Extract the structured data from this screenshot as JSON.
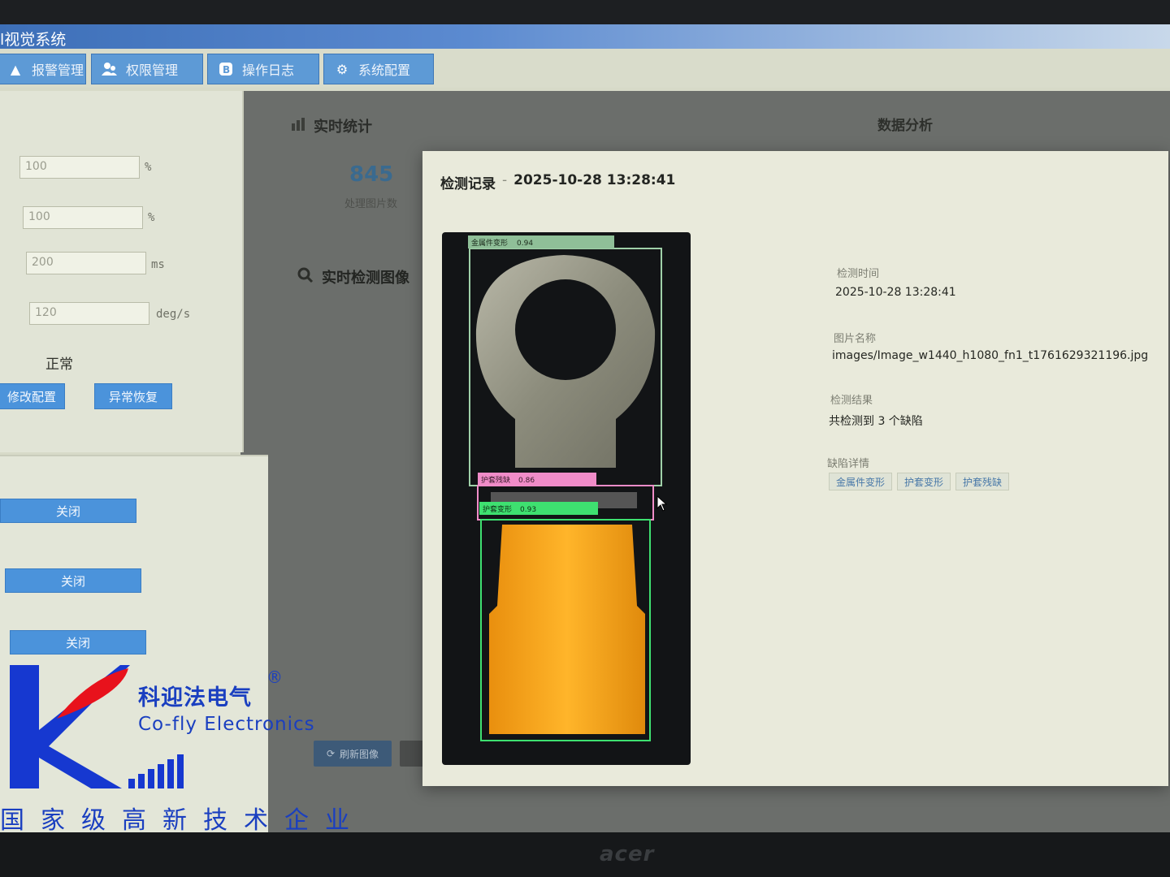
{
  "app": {
    "title": "l视觉系统"
  },
  "nav": [
    {
      "label": "报警管理",
      "icon": "bell-icon"
    },
    {
      "label": "权限管理",
      "icon": "users-icon"
    },
    {
      "label": "操作日志",
      "icon": "log-icon"
    },
    {
      "label": "系统配置",
      "icon": "gear-icon"
    }
  ],
  "settings": {
    "fields": [
      {
        "value": "100",
        "unit": "%"
      },
      {
        "value": "100",
        "unit": "%"
      },
      {
        "value": "200",
        "unit": "ms"
      },
      {
        "value": "120",
        "unit": "deg/s"
      }
    ],
    "status": "正常",
    "modify_button": "修改配置",
    "recover_button": "异常恢复"
  },
  "toggles": [
    {
      "label": "关闭"
    },
    {
      "label": "关闭"
    },
    {
      "label": "关闭"
    }
  ],
  "stats": {
    "title": "实时统计",
    "value": "845",
    "sublabel": "处理图片数"
  },
  "realtime": {
    "title": "实时检测图像"
  },
  "analysis": {
    "title": "数据分析"
  },
  "actions": {
    "refresh": "刷新图像"
  },
  "modal": {
    "title": "检测记录",
    "separator": "-",
    "timestamp": "2025-10-28 13:28:41",
    "detections": [
      {
        "label": "金属件变形",
        "score": "0.94",
        "color": "#8fbf98"
      },
      {
        "label": "护套残缺",
        "score": "0.86",
        "color": "#f08cc8"
      },
      {
        "label": "护套变形",
        "score": "0.93",
        "color": "#3ee070"
      }
    ],
    "info": {
      "time_label": "检测时间",
      "time_value": "2025-10-28 13:28:41",
      "name_label": "图片名称",
      "name_value": "images/Image_w1440_h1080_fn1_t1761629321196.jpg",
      "result_label": "检测结果",
      "result_value": "共检测到 3 个缺陷",
      "defects_label": "缺陷详情",
      "defects": [
        "金属件变形",
        "护套变形",
        "护套残缺"
      ]
    }
  },
  "watermark": {
    "cn": "科迎法电气",
    "en": "Co-fly Electronics",
    "reg": "®",
    "slogan": "国家级高新技术企业"
  },
  "monitor": {
    "brand": "acer"
  }
}
